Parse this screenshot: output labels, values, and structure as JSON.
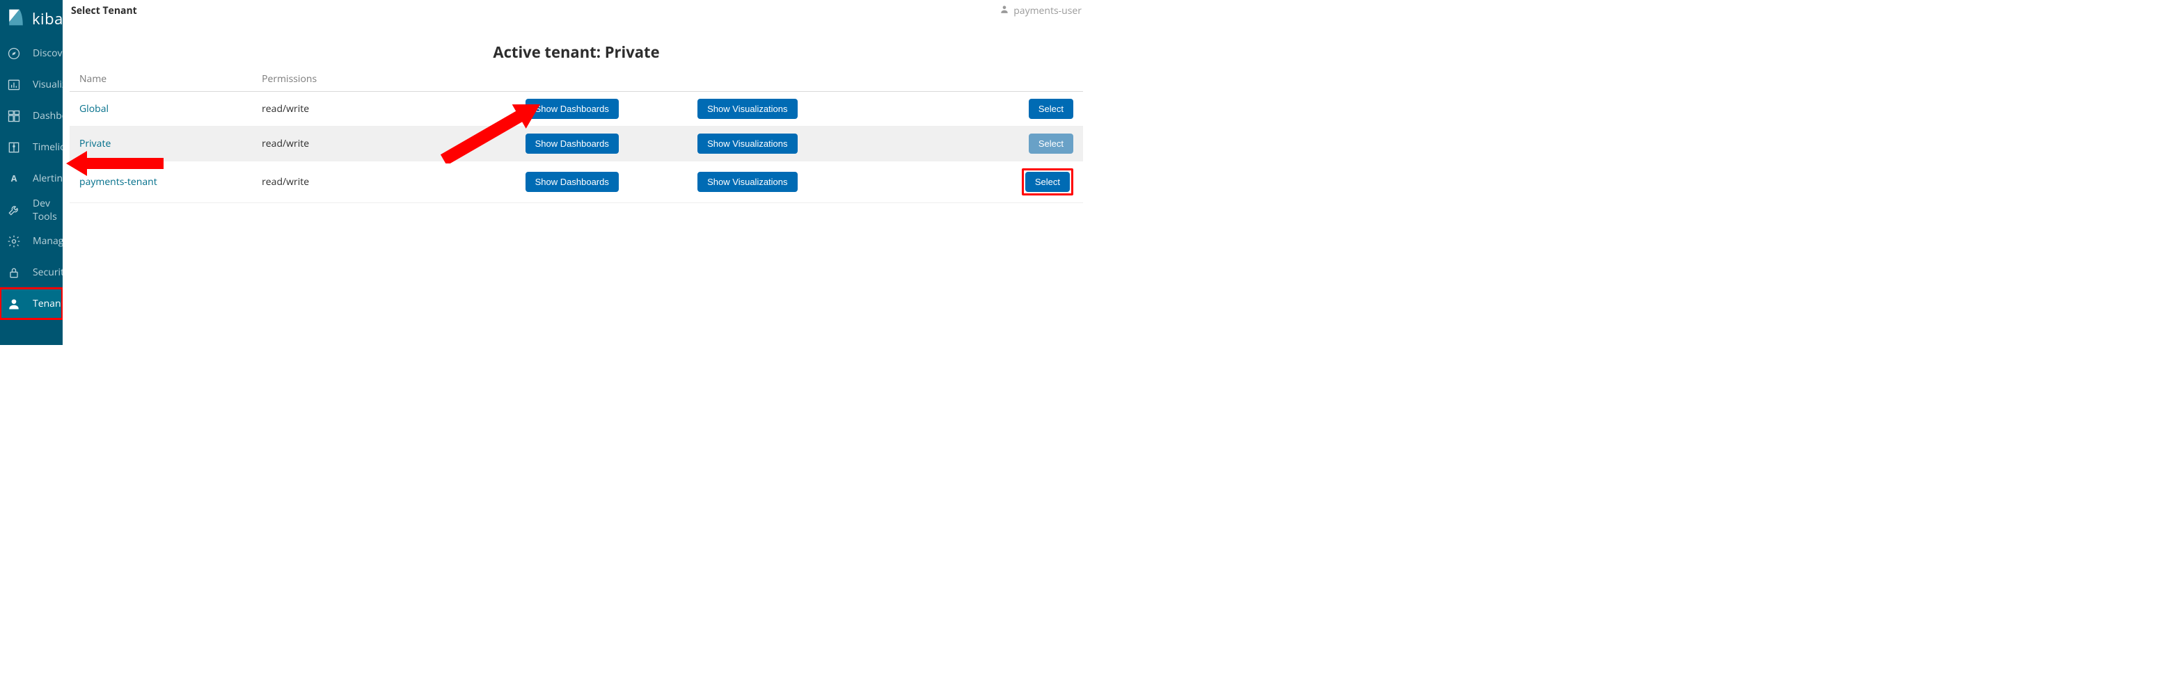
{
  "brand": "kibana",
  "sidebar": {
    "items": [
      {
        "label": "Discover",
        "icon": "compass"
      },
      {
        "label": "Visualize",
        "icon": "barchart"
      },
      {
        "label": "Dashboard",
        "icon": "dashboard"
      },
      {
        "label": "Timelion",
        "icon": "timelion"
      },
      {
        "label": "Alerting",
        "icon": "letter-a"
      },
      {
        "label": "Dev Tools",
        "icon": "wrench"
      },
      {
        "label": "Management",
        "icon": "gear"
      },
      {
        "label": "Security",
        "icon": "lock"
      },
      {
        "label": "Tenants",
        "icon": "user",
        "active": true
      }
    ]
  },
  "topbar": {
    "title": "Select Tenant",
    "user": "payments-user"
  },
  "page": {
    "active_tenant_label": "Active tenant: Private",
    "headers": {
      "name": "Name",
      "permissions": "Permissions"
    },
    "actions": {
      "dashboards": "Show Dashboards",
      "visualizations": "Show Visualizations",
      "select": "Select"
    },
    "rows": [
      {
        "name": "Global",
        "permissions": "read/write",
        "selected": false,
        "annotate": false
      },
      {
        "name": "Private",
        "permissions": "read/write",
        "selected": true,
        "annotate": false
      },
      {
        "name": "payments-tenant",
        "permissions": "read/write",
        "selected": false,
        "annotate": true
      }
    ]
  }
}
